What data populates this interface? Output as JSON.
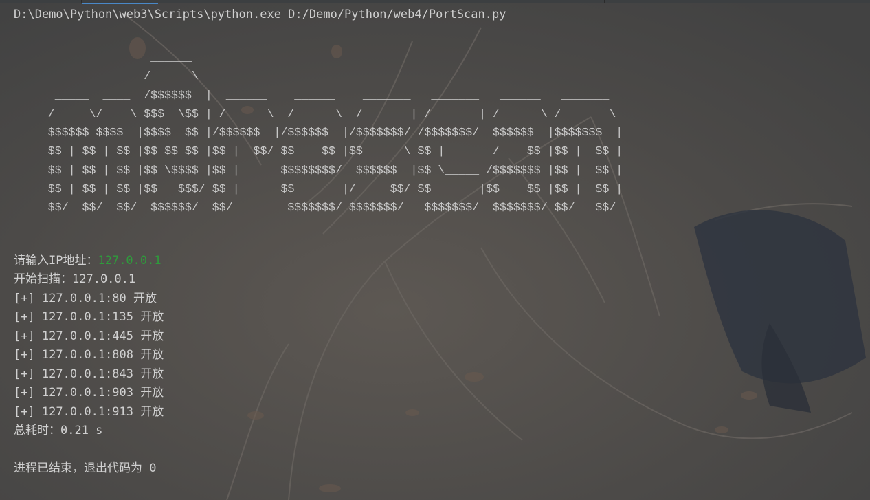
{
  "console": {
    "command": "D:\\Demo\\Python\\web3\\Scripts\\python.exe D:/Demo/Python/web4/PortScan.py",
    "banner": [
      "                    ______",
      "                   /      \\",
      "      _____  ____  /$$$$$$  |  ______    ______    _______   _______   ______   _______",
      "     /     \\/    \\ $$$  \\$$ | /      \\  /      \\  /       | /       | /      \\ /       \\",
      "     $$$$$$ $$$$  |$$$$  $$ |/$$$$$$  |/$$$$$$  |/$$$$$$$/ /$$$$$$$/  $$$$$$  |$$$$$$$  |",
      "     $$ | $$ | $$ |$$ $$ $$ |$$ |  $$/ $$    $$ |$$      \\ $$ |       /    $$ |$$ |  $$ |",
      "     $$ | $$ | $$ |$$ \\$$$$ |$$ |      $$$$$$$$/  $$$$$$  |$$ \\_____ /$$$$$$$ |$$ |  $$ |",
      "     $$ | $$ | $$ |$$   $$$/ $$ |      $$       |/     $$/ $$       |$$    $$ |$$ |  $$ |",
      "     $$/  $$/  $$/  $$$$$$/  $$/        $$$$$$$/ $$$$$$$/   $$$$$$$/  $$$$$$$/ $$/   $$/"
    ],
    "prompt_label": "请输入IP地址：",
    "prompt_value": "127.0.0.1",
    "scan_start": "开始扫描：127.0.0.1",
    "results": [
      "[+] 127.0.0.1:80 开放",
      "[+] 127.0.0.1:135 开放",
      "[+] 127.0.0.1:445 开放",
      "[+] 127.0.0.1:808 开放",
      "[+] 127.0.0.1:843 开放",
      "[+] 127.0.0.1:903 开放",
      "[+] 127.0.0.1:913 开放"
    ],
    "elapsed": "总耗时：0.21 s",
    "exit_message": "进程已结束，退出代码为 0"
  },
  "colors": {
    "background": "#454545",
    "text": "#d0d0d0",
    "input_text": "#2f9a3c",
    "tab_accent": "#4a88c7"
  }
}
